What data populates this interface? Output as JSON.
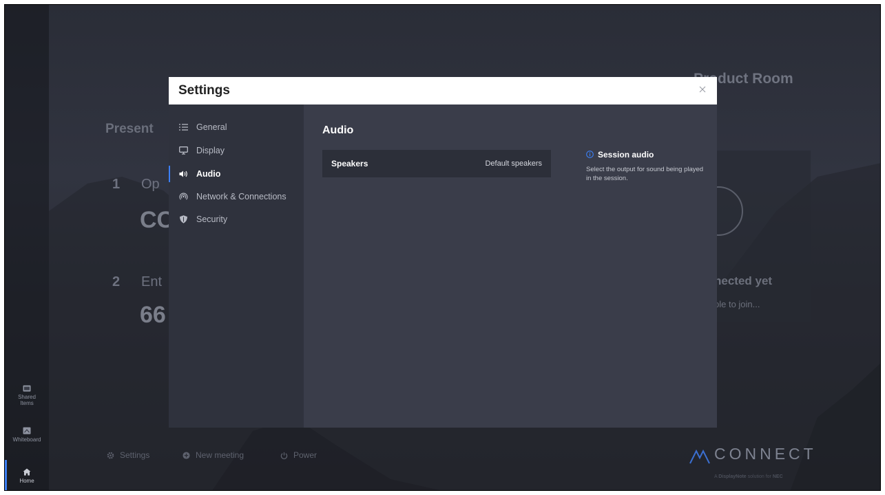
{
  "background": {
    "room_title": "Product Room",
    "present_label": "Present",
    "step1_number": "1",
    "step1_text": "Op",
    "step1_code": "CC",
    "step2_number": "2",
    "step2_text": "Ent",
    "step2_code": "66",
    "status_title": "nected yet",
    "status_sub": "ple to join..."
  },
  "left_bar": {
    "items": [
      {
        "label_line1": "Shared",
        "label_line2": "Items",
        "icon": "folder-icon"
      },
      {
        "label_line1": "Whiteboard",
        "icon": "whiteboard-icon"
      },
      {
        "label_line1": "Home",
        "icon": "home-icon"
      }
    ]
  },
  "bottom_bar": {
    "settings": "Settings",
    "new_meeting": "New meeting",
    "power": "Power"
  },
  "brand": {
    "name": "CONNECT",
    "sub_prefix": "A ",
    "sub_brand": "DisplayNote",
    "sub_mid": " solution for ",
    "sub_partner": "NEC"
  },
  "dialog": {
    "title": "Settings",
    "close_icon": "close-icon",
    "nav": [
      {
        "label": "General",
        "icon": "list-icon"
      },
      {
        "label": "Display",
        "icon": "monitor-icon"
      },
      {
        "label": "Audio",
        "icon": "speaker-icon",
        "active": true
      },
      {
        "label": "Network & Connections",
        "icon": "wifi-icon"
      },
      {
        "label": "Security",
        "icon": "shield-icon"
      }
    ],
    "section_title": "Audio",
    "speakers": {
      "label": "Speakers",
      "value": "Default speakers"
    },
    "help": {
      "title": "Session audio",
      "text": "Select the output for sound being played in the session."
    }
  },
  "colors": {
    "accent": "#3b7ff5",
    "dialog_header": "#ffffff",
    "sidebar": "#2f323d",
    "main": "#3a3d4a"
  }
}
